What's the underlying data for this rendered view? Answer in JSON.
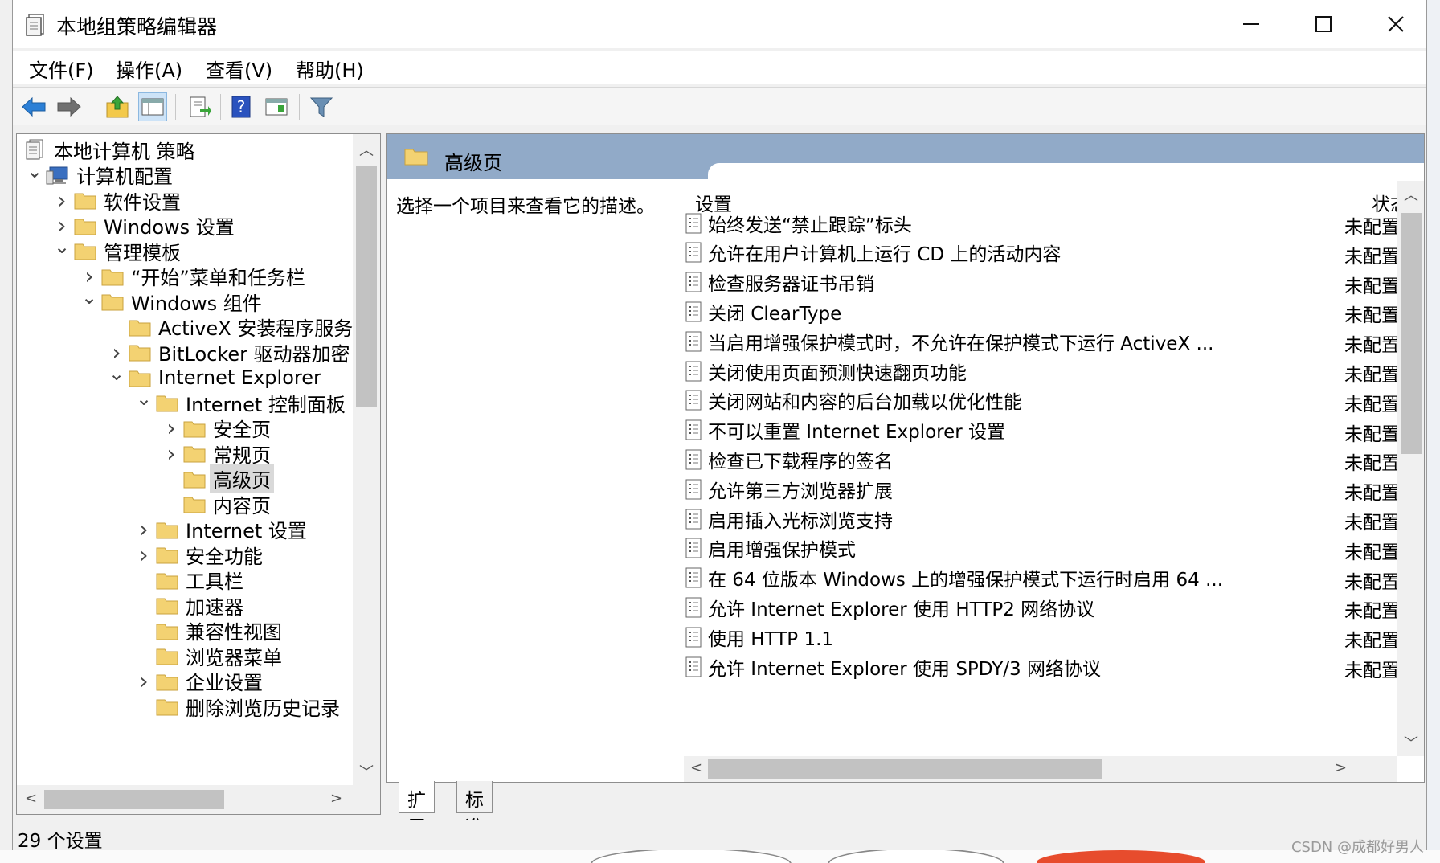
{
  "window": {
    "title": "本地组策略编辑器"
  },
  "menu": [
    "文件(F)",
    "操作(A)",
    "查看(V)",
    "帮助(H)"
  ],
  "toolbar": [
    "back-icon",
    "forward-icon",
    "up-folder-icon",
    "show-hide-tree-icon",
    "export-list-icon",
    "help-icon",
    "properties-icon",
    "filter-icon"
  ],
  "tree": [
    {
      "label": "本地计算机 策略",
      "level": 0,
      "arrow": "",
      "icon": "policy"
    },
    {
      "label": "计算机配置",
      "level": 0,
      "arrow": "v",
      "icon": "computer"
    },
    {
      "label": "软件设置",
      "level": 1,
      "arrow": ">",
      "icon": "folder"
    },
    {
      "label": "Windows 设置",
      "level": 1,
      "arrow": ">",
      "icon": "folder"
    },
    {
      "label": "管理模板",
      "level": 1,
      "arrow": "v",
      "icon": "folder"
    },
    {
      "label": "“开始”菜单和任务栏",
      "level": 2,
      "arrow": ">",
      "icon": "folder"
    },
    {
      "label": "Windows 组件",
      "level": 2,
      "arrow": "v",
      "icon": "folder"
    },
    {
      "label": "ActiveX 安装程序服务",
      "level": 3,
      "arrow": "",
      "icon": "folder"
    },
    {
      "label": "BitLocker 驱动器加密",
      "level": 3,
      "arrow": ">",
      "icon": "folder"
    },
    {
      "label": "Internet Explorer",
      "level": 3,
      "arrow": "v",
      "icon": "folder"
    },
    {
      "label": "Internet 控制面板",
      "level": 4,
      "arrow": "v",
      "icon": "folder"
    },
    {
      "label": "安全页",
      "level": 5,
      "arrow": ">",
      "icon": "folder"
    },
    {
      "label": "常规页",
      "level": 5,
      "arrow": ">",
      "icon": "folder"
    },
    {
      "label": "高级页",
      "level": 5,
      "arrow": "",
      "icon": "folder",
      "selected": true
    },
    {
      "label": "内容页",
      "level": 5,
      "arrow": "",
      "icon": "folder"
    },
    {
      "label": "Internet 设置",
      "level": 4,
      "arrow": ">",
      "icon": "folder"
    },
    {
      "label": "安全功能",
      "level": 4,
      "arrow": ">",
      "icon": "folder"
    },
    {
      "label": "工具栏",
      "level": 4,
      "arrow": "",
      "icon": "folder"
    },
    {
      "label": "加速器",
      "level": 4,
      "arrow": "",
      "icon": "folder"
    },
    {
      "label": "兼容性视图",
      "level": 4,
      "arrow": "",
      "icon": "folder"
    },
    {
      "label": "浏览器菜单",
      "level": 4,
      "arrow": "",
      "icon": "folder"
    },
    {
      "label": "企业设置",
      "level": 4,
      "arrow": ">",
      "icon": "folder"
    },
    {
      "label": "删除浏览历史记录",
      "level": 4,
      "arrow": "",
      "icon": "folder"
    }
  ],
  "details": {
    "header": "高级页",
    "description": "选择一个项目来查看它的描述。",
    "col_setting": "设置",
    "col_state": "状态",
    "policies": [
      {
        "name": "始终发送“禁止跟踪”标头",
        "state": "未配置"
      },
      {
        "name": "允许在用户计算机上运行 CD 上的活动内容",
        "state": "未配置"
      },
      {
        "name": "检查服务器证书吊销",
        "state": "未配置"
      },
      {
        "name": "关闭 ClearType",
        "state": "未配置"
      },
      {
        "name": "当启用增强保护模式时，不允许在保护模式下运行 ActiveX ...",
        "state": "未配置"
      },
      {
        "name": "关闭使用页面预测快速翻页功能",
        "state": "未配置"
      },
      {
        "name": "关闭网站和内容的后台加载以优化性能",
        "state": "未配置"
      },
      {
        "name": "不可以重置 Internet Explorer 设置",
        "state": "未配置"
      },
      {
        "name": "检查已下载程序的签名",
        "state": "未配置"
      },
      {
        "name": "允许第三方浏览器扩展",
        "state": "未配置"
      },
      {
        "name": "启用插入光标浏览支持",
        "state": "未配置"
      },
      {
        "name": "启用增强保护模式",
        "state": "未配置"
      },
      {
        "name": "在 64 位版本 Windows 上的增强保护模式下运行时启用 64 ...",
        "state": "未配置"
      },
      {
        "name": "允许 Internet Explorer 使用 HTTP2 网络协议",
        "state": "未配置"
      },
      {
        "name": "使用 HTTP 1.1",
        "state": "未配置"
      },
      {
        "name": "允许 Internet Explorer 使用 SPDY/3 网络协议",
        "state": "未配置"
      }
    ]
  },
  "tabs": [
    "扩展",
    "标准"
  ],
  "status": "29 个设置",
  "watermark": "CSDN @成都好男人",
  "colors": {
    "header_band": "#91aac8",
    "folder": "#f3d272",
    "selected": "#d9d9d9"
  }
}
